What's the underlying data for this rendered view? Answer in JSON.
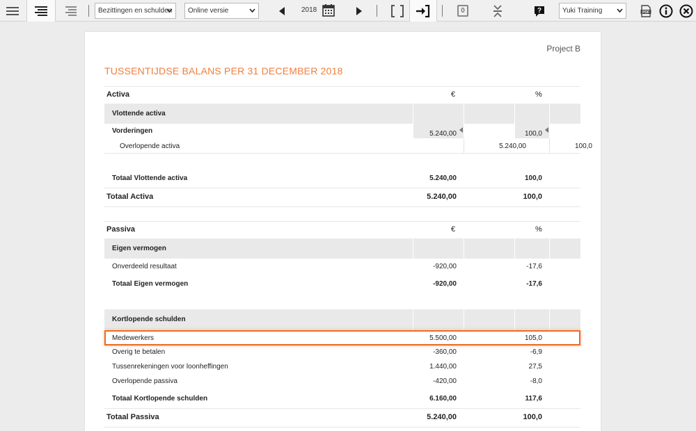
{
  "toolbar": {
    "view_select": "Bezittingen en schulden",
    "version_select": "Online versie",
    "year": "2018",
    "zero_label": "0",
    "admin_select": "Yuki Training"
  },
  "report": {
    "project": "Project B",
    "title": "TUSSENTIJDSE BALANS PER 31 DECEMBER 2018",
    "activa": {
      "heading": "Activa",
      "col_euro": "€",
      "col_pct": "%",
      "group": "Vlottende activa",
      "sub_heading": "Vorderingen",
      "sub_value": "5.240,00",
      "sub_pct": "100,0",
      "detail_label": "Overlopende activa",
      "detail_value": "5.240,00",
      "detail_pct": "100,0",
      "total_group_label": "Totaal Vlottende activa",
      "total_group_value": "5.240,00",
      "total_group_pct": "100,0",
      "total_label": "Totaal Activa",
      "total_value": "5.240,00",
      "total_pct": "100,0"
    },
    "passiva": {
      "heading": "Passiva",
      "col_euro": "€",
      "col_pct": "%",
      "group1": "Eigen vermogen",
      "g1_rows": [
        {
          "label": "Onverdeeld resultaat",
          "value": "-920,00",
          "pct": "-17,6"
        }
      ],
      "g1_total_label": "Totaal Eigen vermogen",
      "g1_total_value": "-920,00",
      "g1_total_pct": "-17,6",
      "group2": "Kortlopende schulden",
      "g2_rows": [
        {
          "label": "Medewerkers",
          "value": "5.500,00",
          "pct": "105,0"
        },
        {
          "label": "Overig te betalen",
          "value": "-360,00",
          "pct": "-6,9"
        },
        {
          "label": "Tussenrekeningen voor loonheffingen",
          "value": "1.440,00",
          "pct": "27,5"
        },
        {
          "label": "Overlopende passiva",
          "value": "-420,00",
          "pct": "-8,0"
        }
      ],
      "g2_total_label": "Totaal Kortlopende schulden",
      "g2_total_value": "6.160,00",
      "g2_total_pct": "117,6",
      "total_label": "Totaal Passiva",
      "total_value": "5.240,00",
      "total_pct": "100,0"
    }
  }
}
